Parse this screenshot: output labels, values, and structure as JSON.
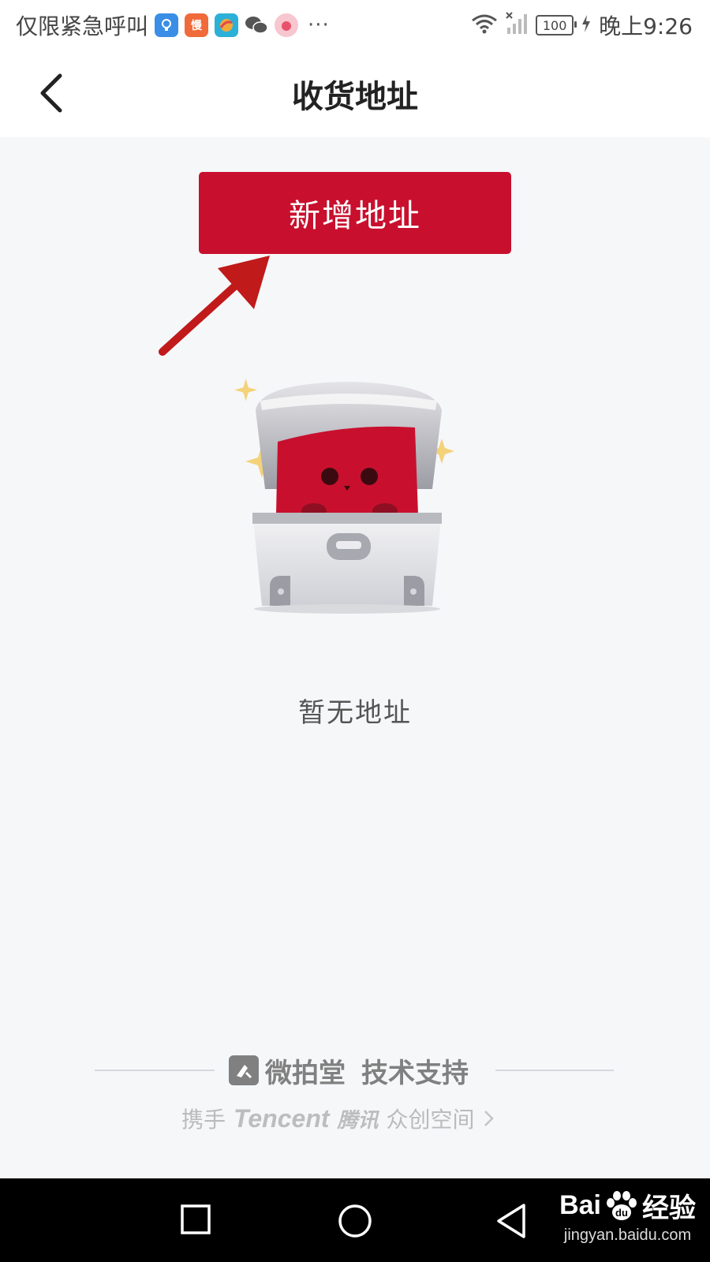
{
  "status_bar": {
    "carrier_text": "仅限紧急呼叫",
    "app_icons": [
      "lightbulb-icon",
      "man-app-icon",
      "browser-app-icon",
      "wechat-icon",
      "pink-app-icon"
    ],
    "more": "···",
    "battery": "100",
    "time": "晚上9:26"
  },
  "header": {
    "back_icon": "chevron-left-icon",
    "title": "收货地址"
  },
  "main": {
    "add_button_label": "新增地址",
    "empty_text": "暂无地址",
    "accent_color": "#c8102e"
  },
  "footer": {
    "brand_name": "微拍堂",
    "support_text": "技术支持",
    "partner_prefix": "携手",
    "partner_brand_en": "Tencent",
    "partner_brand_cn": "腾讯",
    "partner_suffix": "众创空间"
  },
  "nav_bar": {
    "buttons": [
      "recent-apps-icon",
      "home-icon",
      "back-triangle-icon"
    ],
    "watermark_main": "Bai",
    "watermark_brand_cn": "经验",
    "watermark_url": "jingyan.baidu.com"
  }
}
